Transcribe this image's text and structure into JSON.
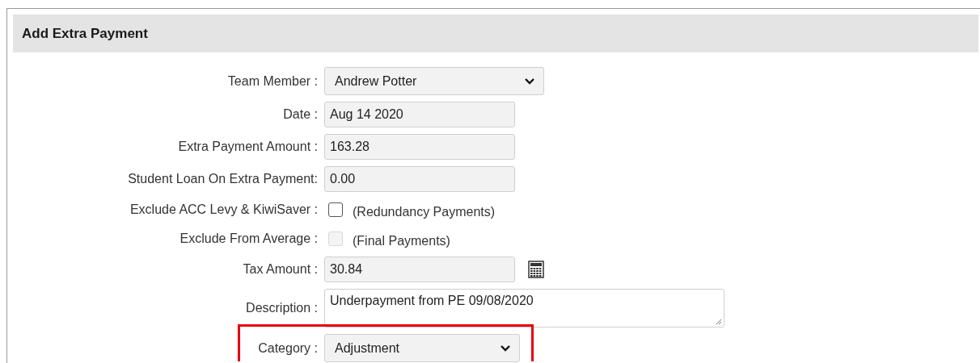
{
  "panel": {
    "title": "Add Extra Payment"
  },
  "fields": [
    {
      "kind": "select",
      "label": "Team Member :",
      "value": "Andrew Potter"
    },
    {
      "kind": "text",
      "label": "Date :",
      "value": "Aug 14 2020"
    },
    {
      "kind": "text",
      "label": "Extra Payment Amount :",
      "value": "163.28"
    },
    {
      "kind": "text",
      "label": "Student Loan On Extra Payment:",
      "value": "0.00"
    },
    {
      "kind": "checkbox",
      "label": "Exclude ACC Levy & KiwiSaver :",
      "note": "(Redundancy Payments)",
      "checked": false,
      "disabled": false
    },
    {
      "kind": "checkbox",
      "label": "Exclude From Average :",
      "note": "(Final Payments)",
      "checked": false,
      "disabled": true
    },
    {
      "kind": "calc",
      "label": "Tax Amount :",
      "value": "30.84"
    },
    {
      "kind": "textarea",
      "label": "Description :",
      "value": "Underpayment from PE 09/08/2020"
    },
    {
      "kind": "select",
      "label": "Category :",
      "value": "Adjustment",
      "highlighted": true
    }
  ]
}
